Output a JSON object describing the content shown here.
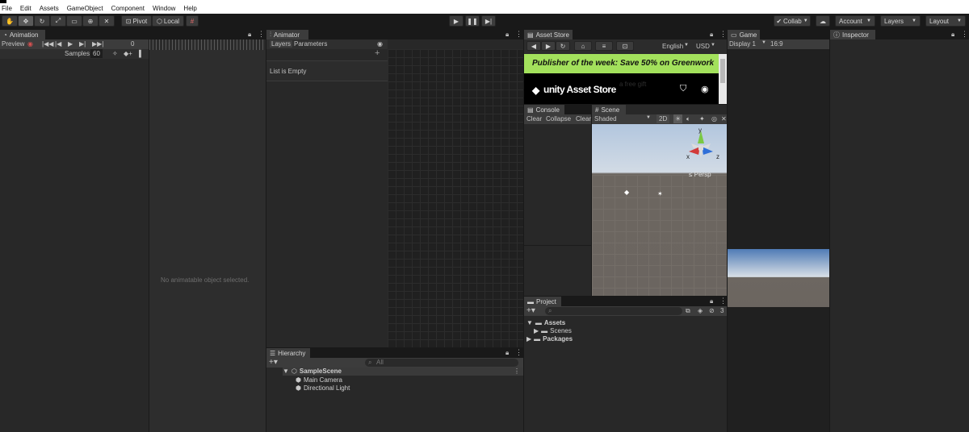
{
  "menu": [
    "File",
    "Edit",
    "Assets",
    "GameObject",
    "Component",
    "Window",
    "Help"
  ],
  "toolbar": {
    "pivot": "Pivot",
    "local": "Local",
    "collab": "Collab",
    "account": "Account",
    "layers": "Layers",
    "layout": "Layout"
  },
  "animation": {
    "tab": "Animation",
    "preview": "Preview",
    "frame": "0",
    "samples_label": "Samples",
    "samples": "60",
    "empty": "No animatable object selected."
  },
  "animator": {
    "tab": "Animator",
    "layers_tab": "Layers",
    "parameters_tab": "Parameters",
    "empty": "List is Empty"
  },
  "asset_store": {
    "tab": "Asset Store",
    "language": "English",
    "currency": "USD",
    "banner": "Publisher of the week: Save 50% on Greenwork",
    "logo": "unity Asset Store",
    "gift": "a free gift"
  },
  "console": {
    "tab": "Console",
    "clear": "Clear",
    "collapse": "Collapse",
    "clear2": "Clear"
  },
  "scene": {
    "tab": "Scene",
    "shading": "Shaded",
    "mode2d": "2D",
    "persp": "Persp",
    "axis_y": "y",
    "axis_x": "x",
    "axis_z": "z"
  },
  "game": {
    "tab": "Game",
    "display": "Display 1",
    "aspect": "16:9"
  },
  "inspector": {
    "tab": "Inspector"
  },
  "project": {
    "tab": "Project",
    "count": "3",
    "assets": "Assets",
    "scenes": "Scenes",
    "packages": "Packages"
  },
  "hierarchy": {
    "tab": "Hierarchy",
    "search": "All",
    "scene": "SampleScene",
    "camera": "Main Camera",
    "light": "Directional Light"
  },
  "colors": {
    "banner": "#a3e15c",
    "store_bg": "#000000",
    "panel": "#282828"
  }
}
